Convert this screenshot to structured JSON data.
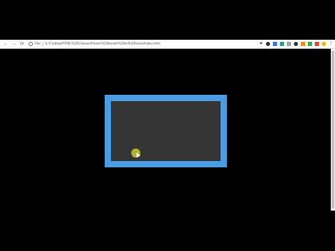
{
  "browser": {
    "nav": {
      "back_icon": "←",
      "forward_icon": "→",
      "reload_icon": "⟳"
    },
    "address_bar": {
      "scheme_label": "File",
      "url": "E:/Coding/HTML%20Classes/Hover%20border%20in%20hover/index.html"
    },
    "extensions": [
      "★",
      "●",
      "▣",
      "▤",
      "⊞",
      "◉",
      "▲",
      "◆",
      "▶",
      "●"
    ],
    "menu_icon": "⋮"
  },
  "page": {
    "background_color": "#000000",
    "box_border_color": "#4a9de2",
    "box_fill_color": "#353535",
    "cursor_highlight_color": "#c9c832"
  }
}
